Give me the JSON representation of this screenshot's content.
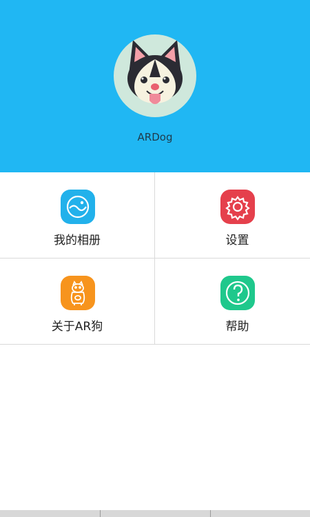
{
  "profile": {
    "name": "ARDog",
    "avatar_icon": "husky-dog-icon"
  },
  "menu": [
    {
      "label": "我的相册",
      "icon": "album-icon",
      "color": "#22b1eb"
    },
    {
      "label": "设置",
      "icon": "gear-icon",
      "color": "#e5404c"
    },
    {
      "label": "关于AR狗",
      "icon": "dog-mascot-icon",
      "color": "#f7941d"
    },
    {
      "label": "帮助",
      "icon": "help-icon",
      "color": "#1fc88c"
    }
  ],
  "colors": {
    "header": "#20b7f3",
    "divider": "#d9d9d9"
  }
}
